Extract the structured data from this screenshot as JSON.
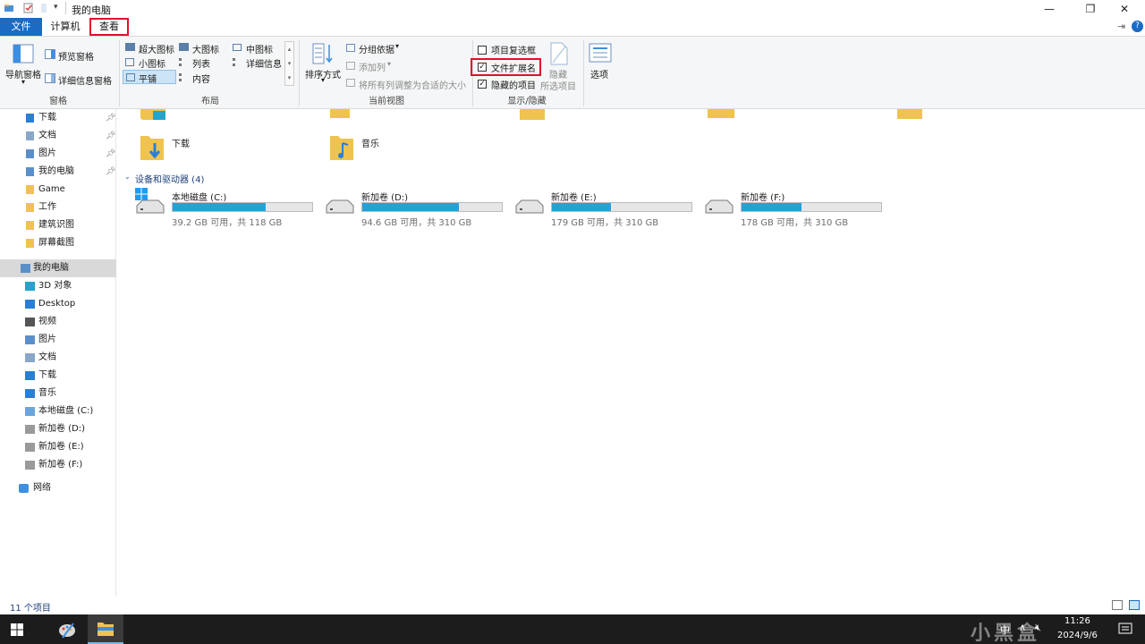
{
  "window": {
    "title": "我的电脑",
    "minimize_glyph": "—",
    "maximize_glyph": "❐",
    "close_glyph": "✕"
  },
  "tabs": {
    "file": "文件",
    "computer": "计算机",
    "view": "查看"
  },
  "ribbon": {
    "panes": {
      "label": "窗格",
      "nav_pane": "导航窗格",
      "preview_pane": "预览窗格",
      "details_pane": "详细信息窗格"
    },
    "layout": {
      "label": "布局",
      "extra_large": "超大图标",
      "large": "大图标",
      "medium": "中图标",
      "small": "小图标",
      "list": "列表",
      "details": "详细信息",
      "tiles": "平铺",
      "content": "内容"
    },
    "current_view": {
      "label": "当前视图",
      "sort_by": "排序方式",
      "group_by": "分组依据",
      "add_columns": "添加列",
      "size_all_columns": "将所有列调整为合适的大小"
    },
    "show_hide": {
      "label": "显示/隐藏",
      "item_checkboxes": "项目复选框",
      "file_extensions": "文件扩展名",
      "hidden_items": "隐藏的项目",
      "hide_selected": "隐藏",
      "hide_selected2": "所选项目",
      "item_checkboxes_checked": false,
      "file_extensions_checked": true,
      "hidden_items_checked": true
    },
    "options": "选项"
  },
  "nav": {
    "quick": [
      {
        "label": "下载"
      },
      {
        "label": "文档"
      },
      {
        "label": "图片"
      },
      {
        "label": "我的电脑"
      },
      {
        "label": "Game"
      },
      {
        "label": "工作"
      },
      {
        "label": "建筑识图"
      },
      {
        "label": "屏幕截图"
      }
    ],
    "this_pc": "我的电脑",
    "pc_items": [
      {
        "label": "3D 对象"
      },
      {
        "label": "Desktop"
      },
      {
        "label": "视频"
      },
      {
        "label": "图片"
      },
      {
        "label": "文档"
      },
      {
        "label": "下载"
      },
      {
        "label": "音乐"
      },
      {
        "label": "本地磁盘 (C:)"
      },
      {
        "label": "新加卷 (D:)"
      },
      {
        "label": "新加卷 (E:)"
      },
      {
        "label": "新加卷 (F:)"
      }
    ],
    "network": "网络"
  },
  "content": {
    "folders": [
      {
        "label": "下载"
      },
      {
        "label": "音乐"
      }
    ],
    "devices_header": "设备和驱动器 (4)",
    "drives": [
      {
        "name": "本地磁盘 (C:)",
        "free": "39.2 GB 可用，共 118 GB",
        "used_fraction": 0.668
      },
      {
        "name": "新加卷 (D:)",
        "free": "94.6 GB 可用，共 310 GB",
        "used_fraction": 0.695
      },
      {
        "name": "新加卷 (E:)",
        "free": "179 GB 可用，共 310 GB",
        "used_fraction": 0.423
      },
      {
        "name": "新加卷 (F:)",
        "free": "178 GB 可用，共 310 GB",
        "used_fraction": 0.426
      }
    ]
  },
  "status": {
    "item_count": "11 个项目"
  },
  "taskbar": {
    "clock_time": "11:26",
    "clock_date": "2024/9/6",
    "ime": "中",
    "watermark": "小黑盒"
  },
  "colors": {
    "accent": "#1a6bc4",
    "drive_fill": "#26a0da",
    "highlight_box": "#e0102a",
    "nav_selected": "#d9d9d9",
    "taskbar": "#1c1c1c"
  }
}
